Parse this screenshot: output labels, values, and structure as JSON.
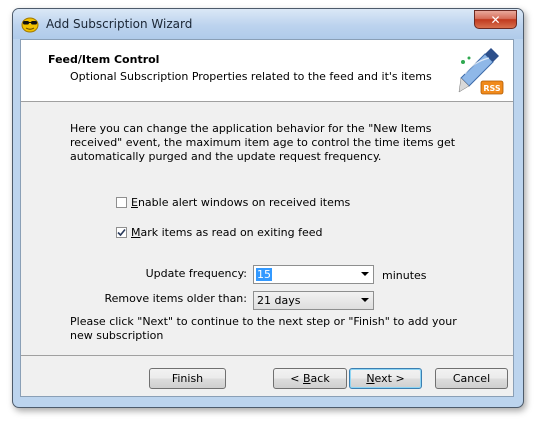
{
  "window": {
    "title": "Add Subscription Wizard",
    "close_glyph": "✕",
    "app_icon": "sunglasses-face-icon"
  },
  "header": {
    "title": "Feed/Item Control",
    "subtitle": "Optional Subscription Properties related to the feed and it's items",
    "logo_icon": "rss-feed-logo",
    "logo_text": "RSS"
  },
  "intro": {
    "text": "Here you can change the application behavior for the \"New Items received\" event, the maximum item age to control the time items get automatically purged and the update request frequency."
  },
  "options": {
    "alert_windows": {
      "label_hotkey": "E",
      "label_rest": "nable alert windows on received items",
      "checked": false
    },
    "mark_read": {
      "label_hotkey": "M",
      "label_rest": "ark items as read on exiting feed",
      "checked": true
    }
  },
  "update_frequency": {
    "label": "Update frequency:",
    "value": "15",
    "suffix": "minutes"
  },
  "remove_items": {
    "label": "Remove items older than:",
    "value": "21 days"
  },
  "footer_text": "Please click \"Next\" to continue to the next step or \"Finish\" to add your new subscription",
  "buttons": {
    "finish": "Finish",
    "back_prefix": "< ",
    "back_hotkey": "B",
    "back_rest": "ack",
    "next_hotkey": "N",
    "next_rest": "ext >",
    "cancel": "Cancel"
  },
  "colors": {
    "titlebar": "#bcd3ee",
    "close_button": "#c0391e",
    "selection": "#3399ff",
    "default_button_border": "#3c7fb1"
  }
}
